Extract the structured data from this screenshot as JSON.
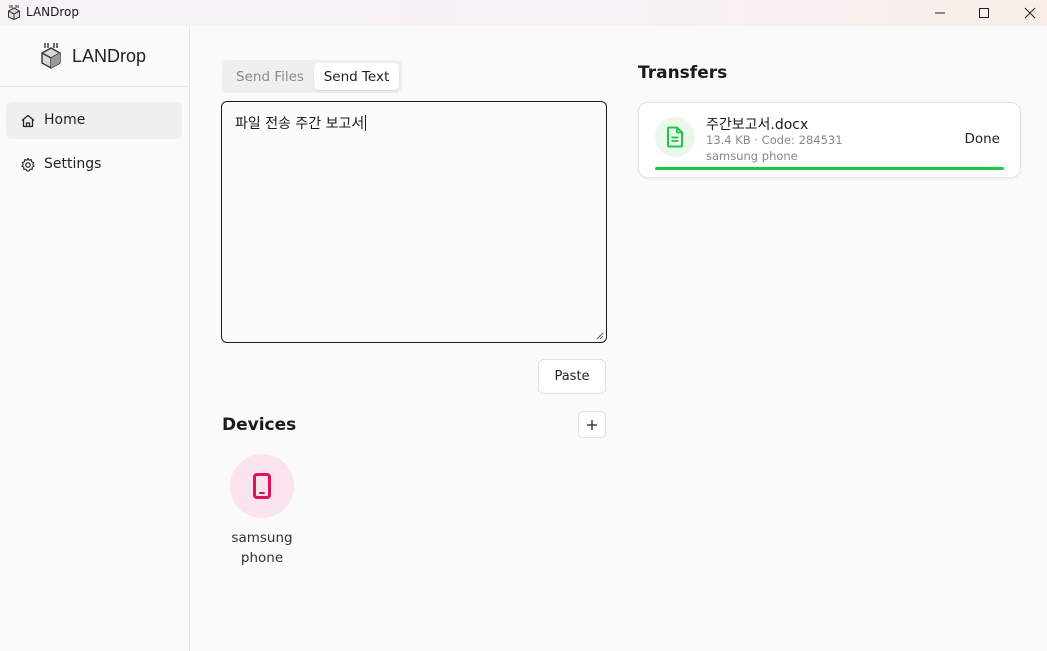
{
  "window": {
    "title": "LANDrop",
    "icon": "app-logo-icon",
    "controls": [
      "minimize-icon",
      "maximize-icon",
      "close-icon"
    ]
  },
  "sidebar": {
    "brand": "LANDrop",
    "items": [
      {
        "label": "Home",
        "icon": "home-icon",
        "active": true
      },
      {
        "label": "Settings",
        "icon": "gear-icon",
        "active": false
      }
    ]
  },
  "send": {
    "tabs": [
      {
        "label": "Send Files",
        "active": false
      },
      {
        "label": "Send Text",
        "active": true
      }
    ],
    "text_value": "파일 전송 주간 보고서",
    "paste_label": "Paste"
  },
  "devices": {
    "title": "Devices",
    "add_icon": "plus-icon",
    "items": [
      {
        "name": "samsung phone",
        "icon": "phone-icon",
        "color": "#e0115f"
      }
    ]
  },
  "transfers": {
    "title": "Transfers",
    "items": [
      {
        "file_name": "주간보고서.docx",
        "meta": "13.4 KB · Code: 284531",
        "device": "samsung phone",
        "status": "Done",
        "progress": 1.0,
        "icon": "document-icon",
        "accent": "#1ec745"
      }
    ]
  }
}
